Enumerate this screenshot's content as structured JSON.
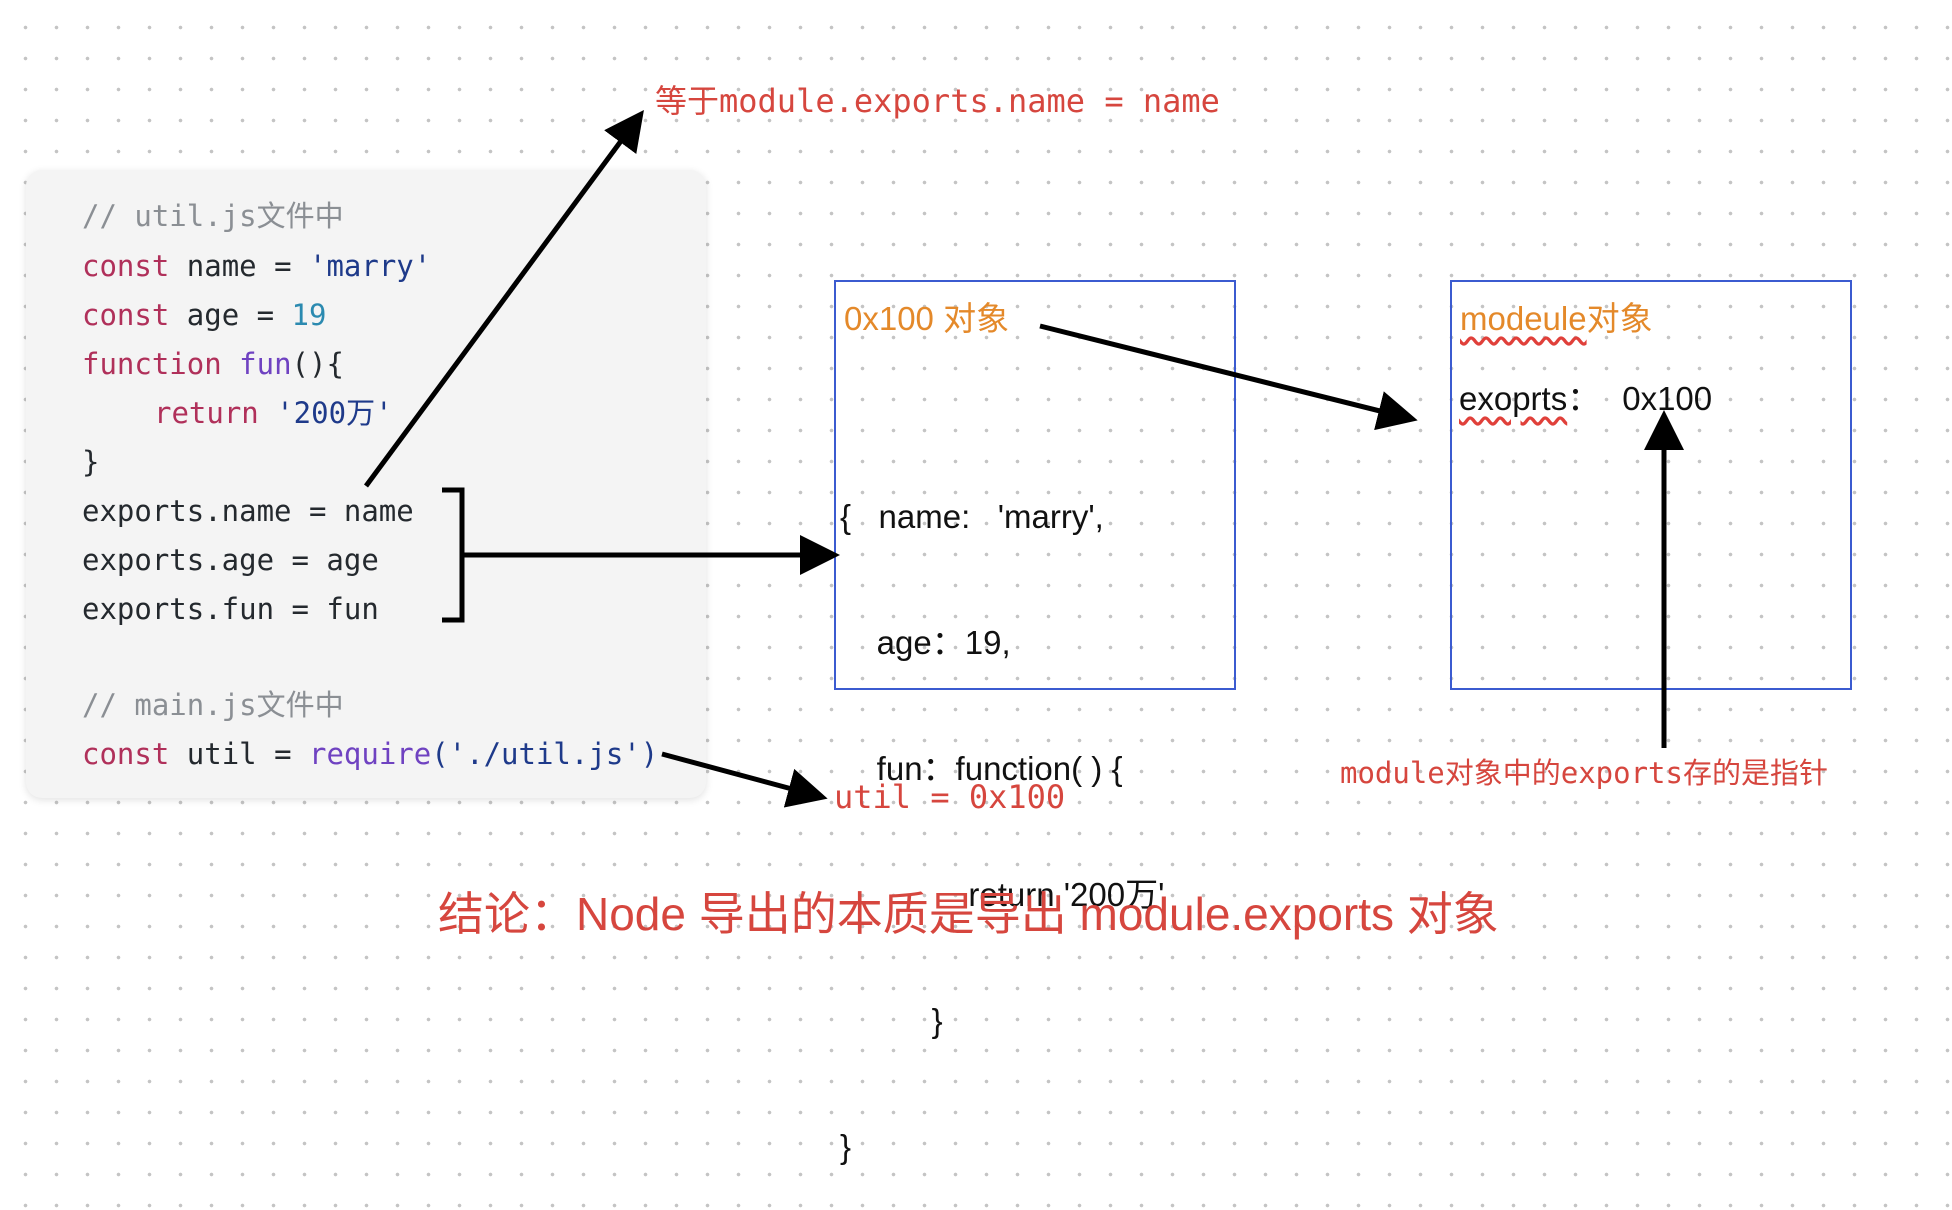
{
  "code": {
    "comment_util": "// util.js文件中",
    "line_name": {
      "kw": "const",
      "rest": " name = ",
      "str": "'marry'"
    },
    "line_age": {
      "kw": "const",
      "rest": " age = ",
      "num": "19"
    },
    "line_fun": {
      "kw": "function",
      "fn": " fun",
      "rest": "(){"
    },
    "line_return": {
      "kw": "return",
      "str": " '200万'"
    },
    "line_close": "}",
    "export_name": "exports.name = name",
    "export_age": "exports.age = age",
    "export_fun": "exports.fun = fun",
    "comment_main": "// main.js文件中",
    "line_require": {
      "kw": "const",
      "rest": " util = ",
      "fn": "require",
      "str": "('./util.js')"
    }
  },
  "annotations": {
    "top": "等于module.exports.name = name",
    "util_value": "util = 0x100",
    "pointer_note": "module对象中的exports存的是指针",
    "conclusion": "结论：Node 导出的本质是导出 module.exports 对象"
  },
  "object_box": {
    "title": "0x100 对象",
    "lines": [
      "{   name:   'marry',",
      "    age：19,",
      "    fun：function( ) {",
      "              return '200万'",
      "          }",
      "}"
    ]
  },
  "module_box": {
    "title_word": "modeule",
    "title_suffix": "对象",
    "prop_key": "exoprts",
    "prop_sep": "：",
    "prop_value": "0x100"
  },
  "colors": {
    "annotation_red": "#d6463e",
    "title_orange": "#e4892a",
    "box_border": "#3b5bd0",
    "arrow": "#000000"
  }
}
